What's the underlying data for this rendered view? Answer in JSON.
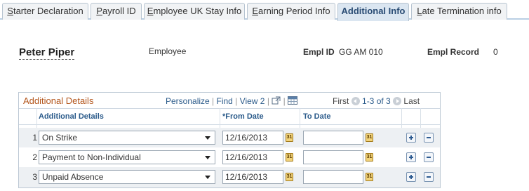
{
  "tabs": [
    {
      "label_u": "S",
      "label_rest": "tarter Declaration"
    },
    {
      "label_u": "P",
      "label_rest": "ayroll ID"
    },
    {
      "label_u": "E",
      "label_rest": "mployee UK Stay Info"
    },
    {
      "label_u": "E",
      "label_rest": "arning Period Info"
    },
    {
      "label": "Additional Info"
    },
    {
      "label_u": "L",
      "label_rest": "ate Termination info"
    }
  ],
  "header": {
    "name": "Peter Piper",
    "role": "Employee",
    "empl_id_label": "Empl ID",
    "empl_id": "GG AM 010",
    "empl_record_label": "Empl Record",
    "empl_record": "0"
  },
  "grid": {
    "title": "Additional Details",
    "nav": {
      "personalize": "Personalize",
      "find": "Find",
      "view2": "View 2",
      "first": "First",
      "range": "1-3 of 3",
      "last": "Last"
    },
    "columns": {
      "details": "Additional Details",
      "from_date": "*From Date",
      "to_date": "To Date"
    },
    "rows": [
      {
        "num": "1",
        "detail": "On Strike",
        "from_date": "12/16/2013",
        "to_date": ""
      },
      {
        "num": "2",
        "detail": "Payment to Non-Individual",
        "from_date": "12/16/2013",
        "to_date": ""
      },
      {
        "num": "3",
        "detail": "Unpaid Absence",
        "from_date": "12/16/2013",
        "to_date": ""
      }
    ]
  },
  "icons": {
    "calendar": "calendar-icon",
    "add": "add-row-icon",
    "delete": "delete-row-icon",
    "zoom": "new-window-icon",
    "download": "download-icon"
  }
}
